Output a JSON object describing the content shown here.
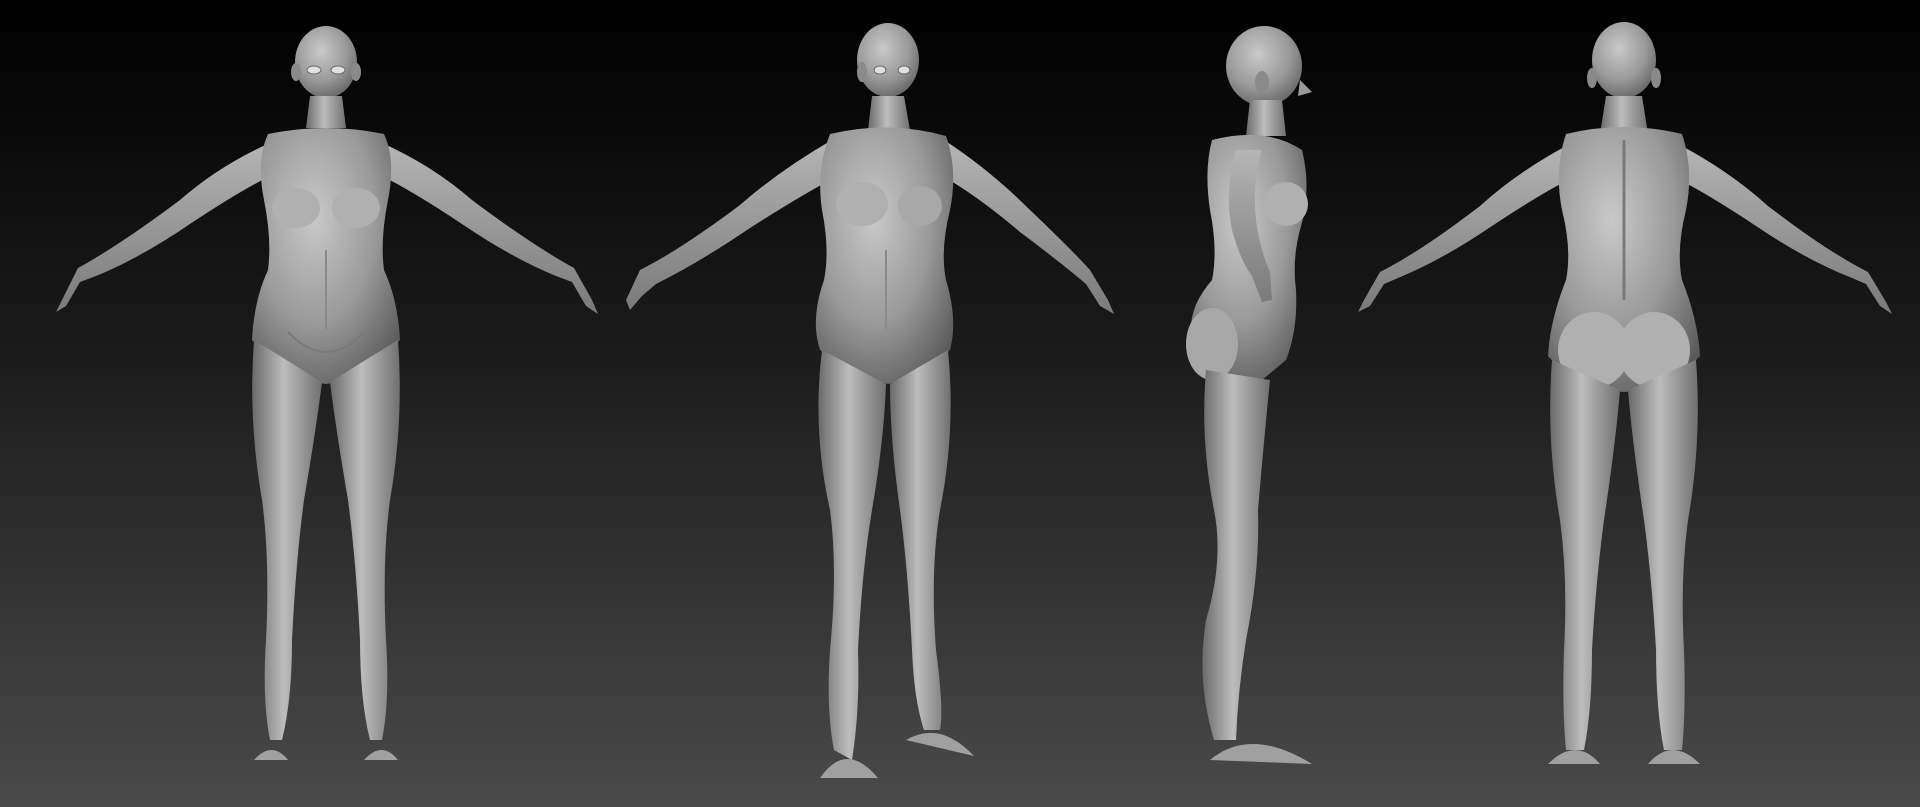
{
  "scene": {
    "background_top": "#000000",
    "background_bottom": "#4a4a4a",
    "figure_light": "#c9c9c9",
    "figure_mid": "#9a9a9a",
    "figure_dark": "#5a5a5a",
    "views": [
      {
        "name": "front-view"
      },
      {
        "name": "three-quarter-view"
      },
      {
        "name": "side-view"
      },
      {
        "name": "back-view"
      }
    ]
  }
}
